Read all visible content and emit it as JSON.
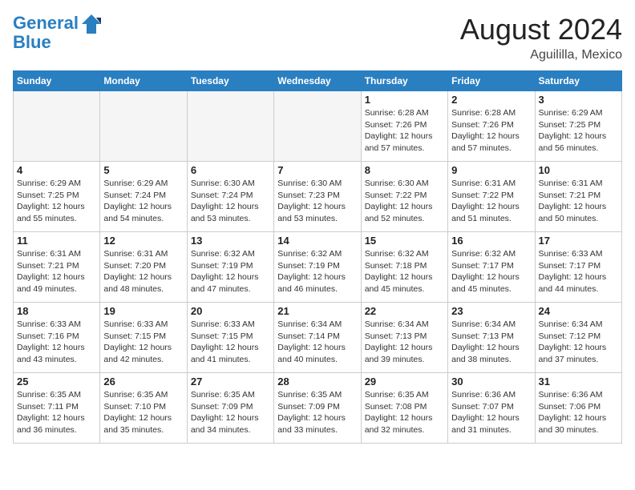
{
  "header": {
    "logo_line1": "General",
    "logo_line2": "Blue",
    "month_title": "August 2024",
    "location": "Aguililla, Mexico"
  },
  "days_of_week": [
    "Sunday",
    "Monday",
    "Tuesday",
    "Wednesday",
    "Thursday",
    "Friday",
    "Saturday"
  ],
  "weeks": [
    [
      {
        "day": "",
        "info": ""
      },
      {
        "day": "",
        "info": ""
      },
      {
        "day": "",
        "info": ""
      },
      {
        "day": "",
        "info": ""
      },
      {
        "day": "1",
        "info": "Sunrise: 6:28 AM\nSunset: 7:26 PM\nDaylight: 12 hours\nand 57 minutes."
      },
      {
        "day": "2",
        "info": "Sunrise: 6:28 AM\nSunset: 7:26 PM\nDaylight: 12 hours\nand 57 minutes."
      },
      {
        "day": "3",
        "info": "Sunrise: 6:29 AM\nSunset: 7:25 PM\nDaylight: 12 hours\nand 56 minutes."
      }
    ],
    [
      {
        "day": "4",
        "info": "Sunrise: 6:29 AM\nSunset: 7:25 PM\nDaylight: 12 hours\nand 55 minutes."
      },
      {
        "day": "5",
        "info": "Sunrise: 6:29 AM\nSunset: 7:24 PM\nDaylight: 12 hours\nand 54 minutes."
      },
      {
        "day": "6",
        "info": "Sunrise: 6:30 AM\nSunset: 7:24 PM\nDaylight: 12 hours\nand 53 minutes."
      },
      {
        "day": "7",
        "info": "Sunrise: 6:30 AM\nSunset: 7:23 PM\nDaylight: 12 hours\nand 53 minutes."
      },
      {
        "day": "8",
        "info": "Sunrise: 6:30 AM\nSunset: 7:22 PM\nDaylight: 12 hours\nand 52 minutes."
      },
      {
        "day": "9",
        "info": "Sunrise: 6:31 AM\nSunset: 7:22 PM\nDaylight: 12 hours\nand 51 minutes."
      },
      {
        "day": "10",
        "info": "Sunrise: 6:31 AM\nSunset: 7:21 PM\nDaylight: 12 hours\nand 50 minutes."
      }
    ],
    [
      {
        "day": "11",
        "info": "Sunrise: 6:31 AM\nSunset: 7:21 PM\nDaylight: 12 hours\nand 49 minutes."
      },
      {
        "day": "12",
        "info": "Sunrise: 6:31 AM\nSunset: 7:20 PM\nDaylight: 12 hours\nand 48 minutes."
      },
      {
        "day": "13",
        "info": "Sunrise: 6:32 AM\nSunset: 7:19 PM\nDaylight: 12 hours\nand 47 minutes."
      },
      {
        "day": "14",
        "info": "Sunrise: 6:32 AM\nSunset: 7:19 PM\nDaylight: 12 hours\nand 46 minutes."
      },
      {
        "day": "15",
        "info": "Sunrise: 6:32 AM\nSunset: 7:18 PM\nDaylight: 12 hours\nand 45 minutes."
      },
      {
        "day": "16",
        "info": "Sunrise: 6:32 AM\nSunset: 7:17 PM\nDaylight: 12 hours\nand 45 minutes."
      },
      {
        "day": "17",
        "info": "Sunrise: 6:33 AM\nSunset: 7:17 PM\nDaylight: 12 hours\nand 44 minutes."
      }
    ],
    [
      {
        "day": "18",
        "info": "Sunrise: 6:33 AM\nSunset: 7:16 PM\nDaylight: 12 hours\nand 43 minutes."
      },
      {
        "day": "19",
        "info": "Sunrise: 6:33 AM\nSunset: 7:15 PM\nDaylight: 12 hours\nand 42 minutes."
      },
      {
        "day": "20",
        "info": "Sunrise: 6:33 AM\nSunset: 7:15 PM\nDaylight: 12 hours\nand 41 minutes."
      },
      {
        "day": "21",
        "info": "Sunrise: 6:34 AM\nSunset: 7:14 PM\nDaylight: 12 hours\nand 40 minutes."
      },
      {
        "day": "22",
        "info": "Sunrise: 6:34 AM\nSunset: 7:13 PM\nDaylight: 12 hours\nand 39 minutes."
      },
      {
        "day": "23",
        "info": "Sunrise: 6:34 AM\nSunset: 7:13 PM\nDaylight: 12 hours\nand 38 minutes."
      },
      {
        "day": "24",
        "info": "Sunrise: 6:34 AM\nSunset: 7:12 PM\nDaylight: 12 hours\nand 37 minutes."
      }
    ],
    [
      {
        "day": "25",
        "info": "Sunrise: 6:35 AM\nSunset: 7:11 PM\nDaylight: 12 hours\nand 36 minutes."
      },
      {
        "day": "26",
        "info": "Sunrise: 6:35 AM\nSunset: 7:10 PM\nDaylight: 12 hours\nand 35 minutes."
      },
      {
        "day": "27",
        "info": "Sunrise: 6:35 AM\nSunset: 7:09 PM\nDaylight: 12 hours\nand 34 minutes."
      },
      {
        "day": "28",
        "info": "Sunrise: 6:35 AM\nSunset: 7:09 PM\nDaylight: 12 hours\nand 33 minutes."
      },
      {
        "day": "29",
        "info": "Sunrise: 6:35 AM\nSunset: 7:08 PM\nDaylight: 12 hours\nand 32 minutes."
      },
      {
        "day": "30",
        "info": "Sunrise: 6:36 AM\nSunset: 7:07 PM\nDaylight: 12 hours\nand 31 minutes."
      },
      {
        "day": "31",
        "info": "Sunrise: 6:36 AM\nSunset: 7:06 PM\nDaylight: 12 hours\nand 30 minutes."
      }
    ]
  ]
}
